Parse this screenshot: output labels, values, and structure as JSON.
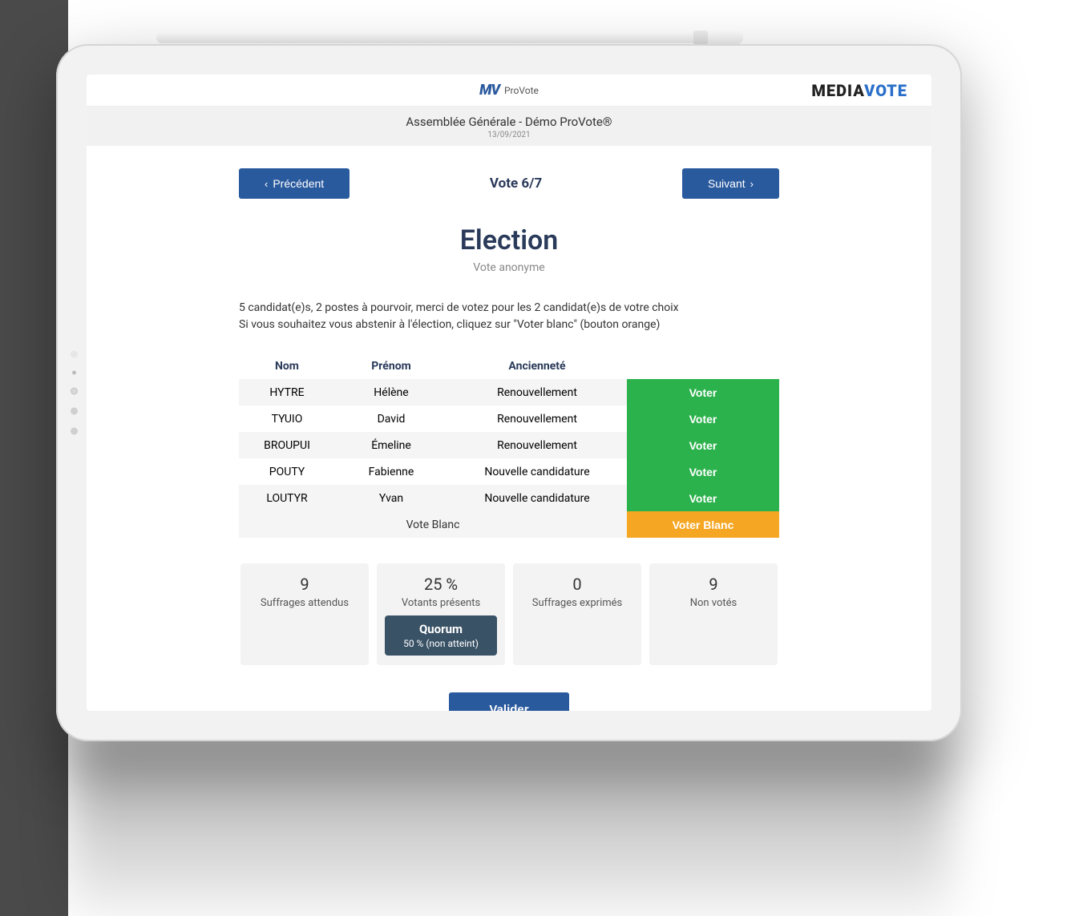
{
  "header": {
    "app_name": "ProVote",
    "brand_dark": "MEDIA",
    "brand_blue": "VOTE",
    "assembly_title": "Assemblée Générale - Démo ProVote®",
    "assembly_date": "13/09/2021"
  },
  "nav": {
    "prev_label": "Précédent",
    "next_label": "Suivant",
    "vote_counter": "Vote 6/7"
  },
  "main": {
    "title": "Election",
    "subtitle": "Vote anonyme",
    "instruction_line1": "5 candidat(e)s, 2 postes à pourvoir, merci de votez pour les 2 candidat(e)s de votre choix",
    "instruction_line2": "Si vous souhaitez vous abstenir à l'élection, cliquez sur \"Voter blanc\" (bouton orange)"
  },
  "table": {
    "headers": {
      "nom": "Nom",
      "prenom": "Prénom",
      "anc": "Ancienneté"
    },
    "vote_label": "Voter",
    "blank_row_label": "Vote Blanc",
    "blank_button_label": "Voter Blanc",
    "rows": [
      {
        "nom": "HYTRE",
        "prenom": "Hélène",
        "anc": "Renouvellement"
      },
      {
        "nom": "TYUIO",
        "prenom": "David",
        "anc": "Renouvellement"
      },
      {
        "nom": "BROUPUI",
        "prenom": "Émeline",
        "anc": "Renouvellement"
      },
      {
        "nom": "POUTY",
        "prenom": "Fabienne",
        "anc": "Nouvelle candidature"
      },
      {
        "nom": "LOUTYR",
        "prenom": "Yvan",
        "anc": "Nouvelle candidature"
      }
    ]
  },
  "stats": {
    "expected": {
      "value": "9",
      "label": "Suffrages attendus"
    },
    "present": {
      "value": "25 %",
      "label": "Votants présents"
    },
    "expressed": {
      "value": "0",
      "label": "Suffrages exprimés"
    },
    "notvoted": {
      "value": "9",
      "label": "Non votés"
    },
    "quorum": {
      "title": "Quorum",
      "sub": "50 % (non atteint)"
    }
  },
  "validate_label": "Valider"
}
